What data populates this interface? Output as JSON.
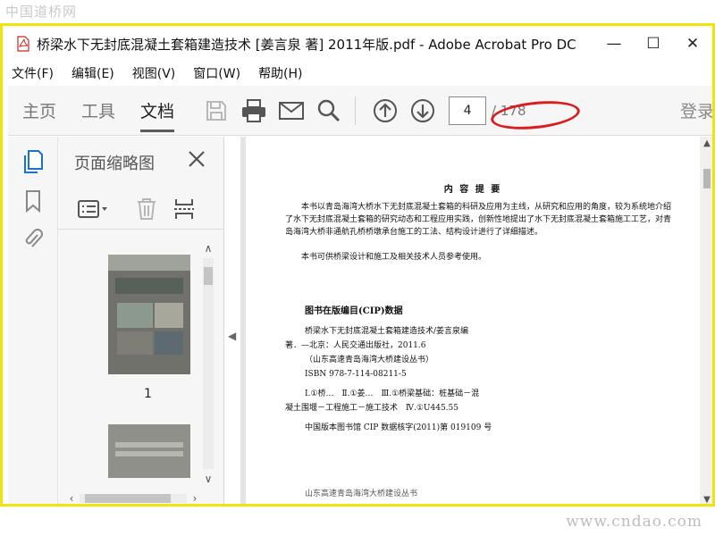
{
  "watermark": {
    "top": "中国道桥网",
    "bottom": "www.cndao.com"
  },
  "window": {
    "title": "桥梁水下无封底混凝土套箱建造技术 [姜言泉 著] 2011年版.pdf - Adobe Acrobat Pro DC",
    "minimize": "—",
    "maximize": "☐",
    "close": "✕"
  },
  "menu": [
    "文件(F)",
    "编辑(E)",
    "视图(V)",
    "窗口(W)",
    "帮助(H)"
  ],
  "toolbar": {
    "tabs": [
      "主页",
      "工具",
      "文档"
    ],
    "active_tab": "文档",
    "current_page": "4",
    "total_pages": "/ 178",
    "login": "登录",
    "highlight_color": "#d81f1f"
  },
  "sidebar": {
    "panel_title": "页面缩略图",
    "thumbnails": [
      {
        "label": "1"
      }
    ]
  },
  "document": {
    "heading": "内 容 提 要",
    "paragraph1": "本书以青岛海湾大桥水下无封底混凝土套箱的科研及应用为主线，从研究和应用的角度，较为系统地介绍了水下无封底混凝土套箱的研究动态和工程应用实践，创新性地提出了水下无封底混凝土套箱施工工艺，对青岛海湾大桥非通航孔桥桥墩承台施工的工法、结构设计进行了详细描述。",
    "paragraph2": "本书可供桥梁设计和施工及相关技术人员参考使用。",
    "cip_title": "图书在版编目(CIP)数据",
    "cip_lines": [
      "桥梁水下无封底混凝土套箱建造技术/姜言泉编",
      "著．—北京：人民交通出版社，2011.6",
      "（山东高速青岛海湾大桥建设丛书）",
      "ISBN 978-7-114-08211-5",
      "Ⅰ.①桥…　Ⅱ.①姜…　Ⅲ.①桥梁基础：桩基础－混",
      "凝土围堰－工程施工－施工技术　Ⅳ.①U445.55",
      "中国版本图书馆 CIP 数据核字(2011)第 019109 号"
    ],
    "footer_partial": "山东高速青岛海湾大桥建设丛书"
  }
}
